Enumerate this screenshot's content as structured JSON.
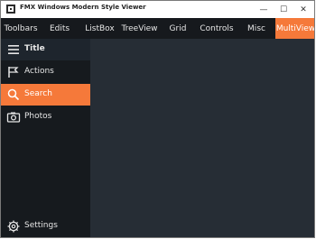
{
  "window": {
    "title": "FMX Windows Modern Style Viewer"
  },
  "title_controls": {
    "minimize": "—",
    "maximize": "☐",
    "close": "✕"
  },
  "tabs": [
    {
      "label": "Toolbars",
      "active": false
    },
    {
      "label": "Edits",
      "active": false
    },
    {
      "label": "ListBox",
      "active": false
    },
    {
      "label": "TreeView",
      "active": false
    },
    {
      "label": "Grid",
      "active": false
    },
    {
      "label": "Controls",
      "active": false
    },
    {
      "label": "Misc",
      "active": false
    },
    {
      "label": "MultiView",
      "active": true
    }
  ],
  "sidebar": {
    "header": {
      "icon": "hamburger-menu-icon",
      "label": "Title"
    },
    "items": [
      {
        "icon": "flag-icon",
        "label": "Actions",
        "active": false
      },
      {
        "icon": "search-icon",
        "label": "Search",
        "active": true
      },
      {
        "icon": "camera-icon",
        "label": "Photos",
        "active": false
      }
    ],
    "footer": {
      "icon": "gear-icon",
      "label": "Settings"
    }
  },
  "colors": {
    "accent": "#f5793a",
    "tabbar_bg": "#16191d",
    "sidebar_bg": "#161a1e",
    "sidebar_header_bg": "#1e252d",
    "content_bg": "#262d35",
    "text": "#e6e6e6"
  }
}
